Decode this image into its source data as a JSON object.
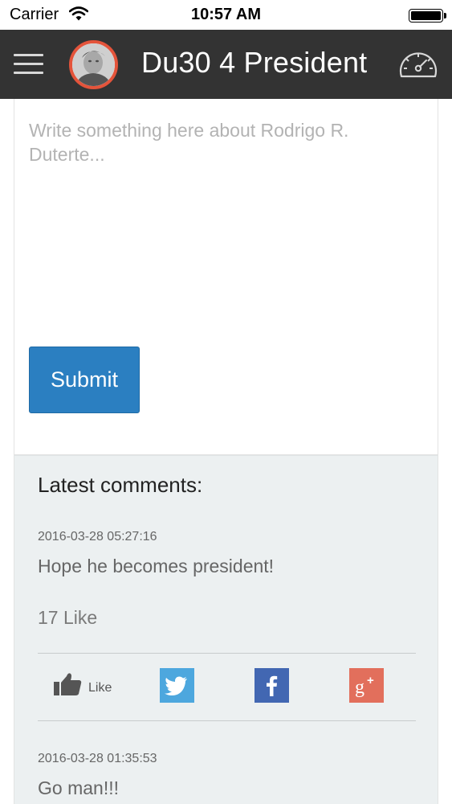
{
  "status_bar": {
    "carrier": "Carrier",
    "time": "10:57 AM",
    "battery_level": 1.0
  },
  "nav": {
    "title": "Du30 4 President"
  },
  "form": {
    "placeholder": "Write something here about Rodrigo R. Duterte...",
    "value": "",
    "submit_label": "Submit"
  },
  "comments": {
    "heading": "Latest comments:",
    "items": [
      {
        "date": "2016-03-28 05:27:16",
        "text": "Hope he becomes president!",
        "likes": "17 Like"
      },
      {
        "date": "2016-03-28 01:35:53",
        "text": "Go man!!!"
      }
    ],
    "like_label": "Like"
  },
  "colors": {
    "navbar": "#333333",
    "avatar_ring": "#e4543b",
    "submit": "#2b7fc1",
    "twitter": "#4da7de",
    "facebook": "#4267b2",
    "google_plus": "#e26f5c",
    "comments_bg": "#ecf0f1"
  },
  "icons": [
    "menu-icon",
    "speedometer-icon",
    "thumbs-up-icon",
    "twitter-icon",
    "facebook-icon",
    "google-plus-icon"
  ]
}
